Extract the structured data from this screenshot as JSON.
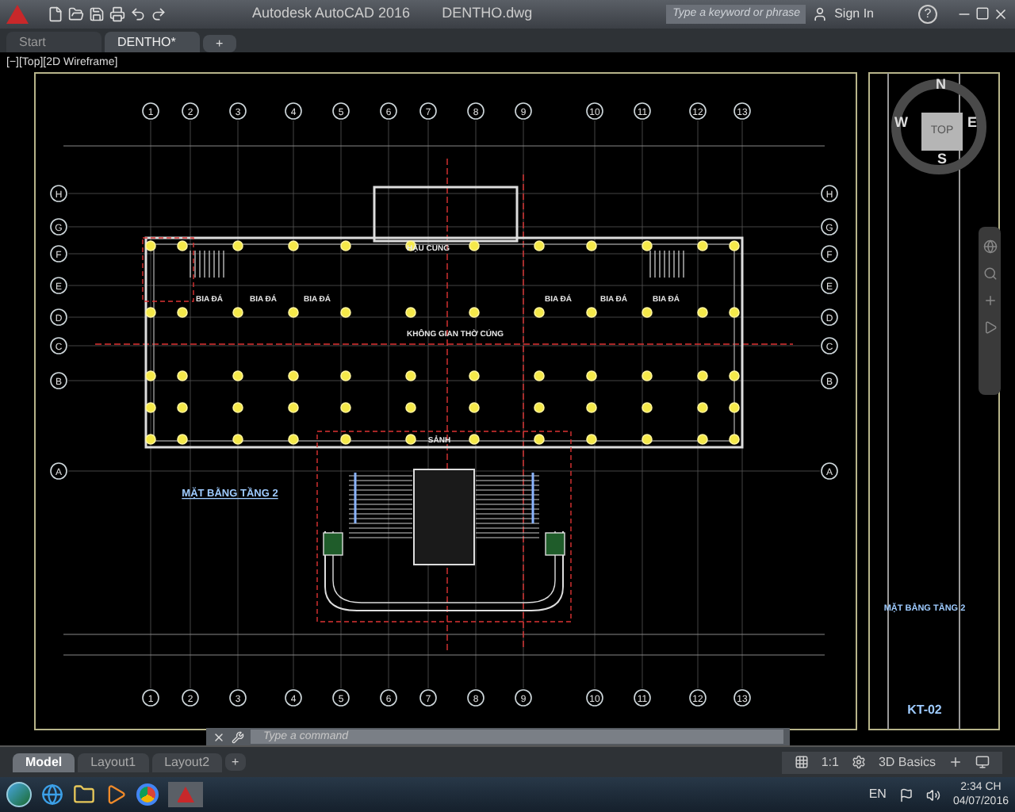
{
  "window": {
    "title": "Autodesk AutoCAD 2016",
    "file": "DENTHO.dwg"
  },
  "search": {
    "placeholder": "Type a keyword or phrase"
  },
  "account": {
    "label": "Sign In"
  },
  "help": {
    "label": "?"
  },
  "doc_tabs": [
    {
      "label": "Start",
      "selected": false
    },
    {
      "label": "DENTHO*",
      "selected": true
    }
  ],
  "new_tab": "+",
  "viewport_label": "[−][Top][2D Wireframe]",
  "viewcube": {
    "face": "TOP",
    "north": "N",
    "south": "S",
    "east": "E",
    "west": "W"
  },
  "drawing": {
    "top_grid_columns": [
      "1",
      "2",
      "3",
      "4",
      "5",
      "6",
      "7",
      "8",
      "9",
      "10",
      "11",
      "12",
      "13"
    ],
    "bottom_grid_columns": [
      "1",
      "2",
      "3",
      "4",
      "5",
      "6",
      "7",
      "8",
      "9",
      "10",
      "11",
      "12",
      "13"
    ],
    "left_grid_rows": [
      "H",
      "G",
      "F",
      "E",
      "D",
      "C",
      "B",
      "A"
    ],
    "right_grid_rows": [
      "H",
      "G",
      "F",
      "E",
      "D",
      "C",
      "B",
      "A"
    ],
    "room_labels": [
      "HẬU CUNG",
      "BIA ĐÁ",
      "BIA ĐÁ",
      "BIA ĐÁ",
      "BIA ĐÁ",
      "BIA ĐÁ",
      "BIA ĐÁ",
      "KHÔNG GIAN THỜ CÚNG",
      "SẢNH"
    ],
    "plan_title": "MẶT BẰNG TẦNG 2",
    "sheet_title": "MẶT BẰNG TẦNG 2",
    "sheet_number": "KT-02"
  },
  "command_line": {
    "placeholder": "Type a command"
  },
  "layout_tabs": [
    {
      "label": "Model",
      "selected": true
    },
    {
      "label": "Layout1",
      "selected": false
    },
    {
      "label": "Layout2",
      "selected": false
    }
  ],
  "add_layout": "+",
  "status_bar": {
    "scale": "1:1",
    "workspace": "3D Basics"
  },
  "taskbar": {
    "language": "EN",
    "time": "2:34 CH",
    "date": "04/07/2016"
  }
}
